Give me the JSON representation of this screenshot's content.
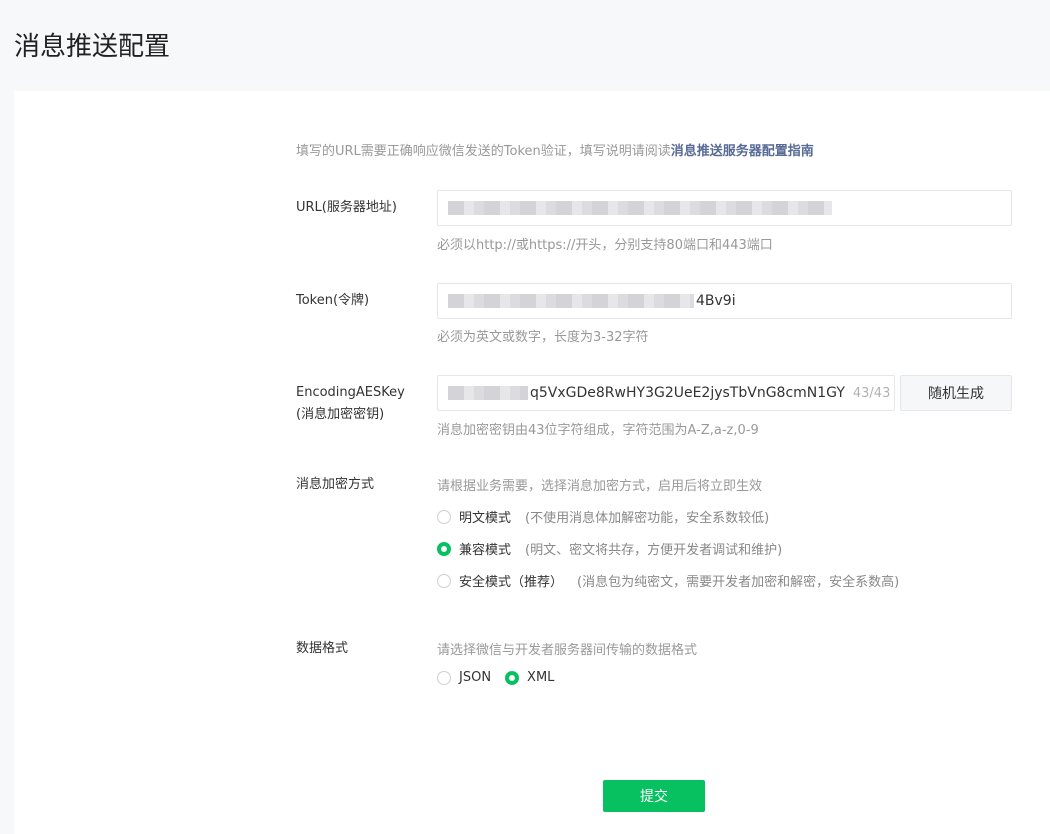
{
  "page": {
    "title": "消息推送配置"
  },
  "intro": {
    "text": "填写的URL需要正确响应微信发送的Token验证，填写说明请阅读",
    "link": "消息推送服务器配置指南"
  },
  "url": {
    "label": "URL(服务器地址)",
    "value_visible": "",
    "hint": "必须以http://或https://开头，分别支持80端口和443端口"
  },
  "token": {
    "label": "Token(令牌)",
    "value_visible": "4Bv9i",
    "hint": "必须为英文或数字，长度为3-32字符"
  },
  "aeskey": {
    "label_line1": "EncodingAESKey",
    "label_line2": "(消息加密密钥)",
    "value_visible": "q5VxGDe8RwHY3G2UeE2jysTbVnG8cmN1GY",
    "counter": "43/43",
    "generate_button": "随机生成",
    "hint": "消息加密密钥由43位字符组成，字符范围为A-Z,a-z,0-9"
  },
  "encryption": {
    "label": "消息加密方式",
    "hint": "请根据业务需要，选择消息加密方式，启用后将立即生效",
    "options": [
      {
        "label": "明文模式",
        "desc": "(不使用消息体加解密功能，安全系数较低)",
        "checked": false
      },
      {
        "label": "兼容模式",
        "desc": "(明文、密文将共存，方便开发者调试和维护)",
        "checked": true
      },
      {
        "label": "安全模式（推荐）",
        "desc": "(消息包为纯密文，需要开发者加密和解密，安全系数高)",
        "checked": false
      }
    ]
  },
  "format": {
    "label": "数据格式",
    "hint": "请选择微信与开发者服务器间传输的数据格式",
    "options": [
      {
        "label": "JSON",
        "checked": false
      },
      {
        "label": "XML",
        "checked": true
      }
    ]
  },
  "submit": {
    "label": "提交"
  },
  "colors": {
    "accent": "#07c160",
    "link": "#576b95"
  }
}
